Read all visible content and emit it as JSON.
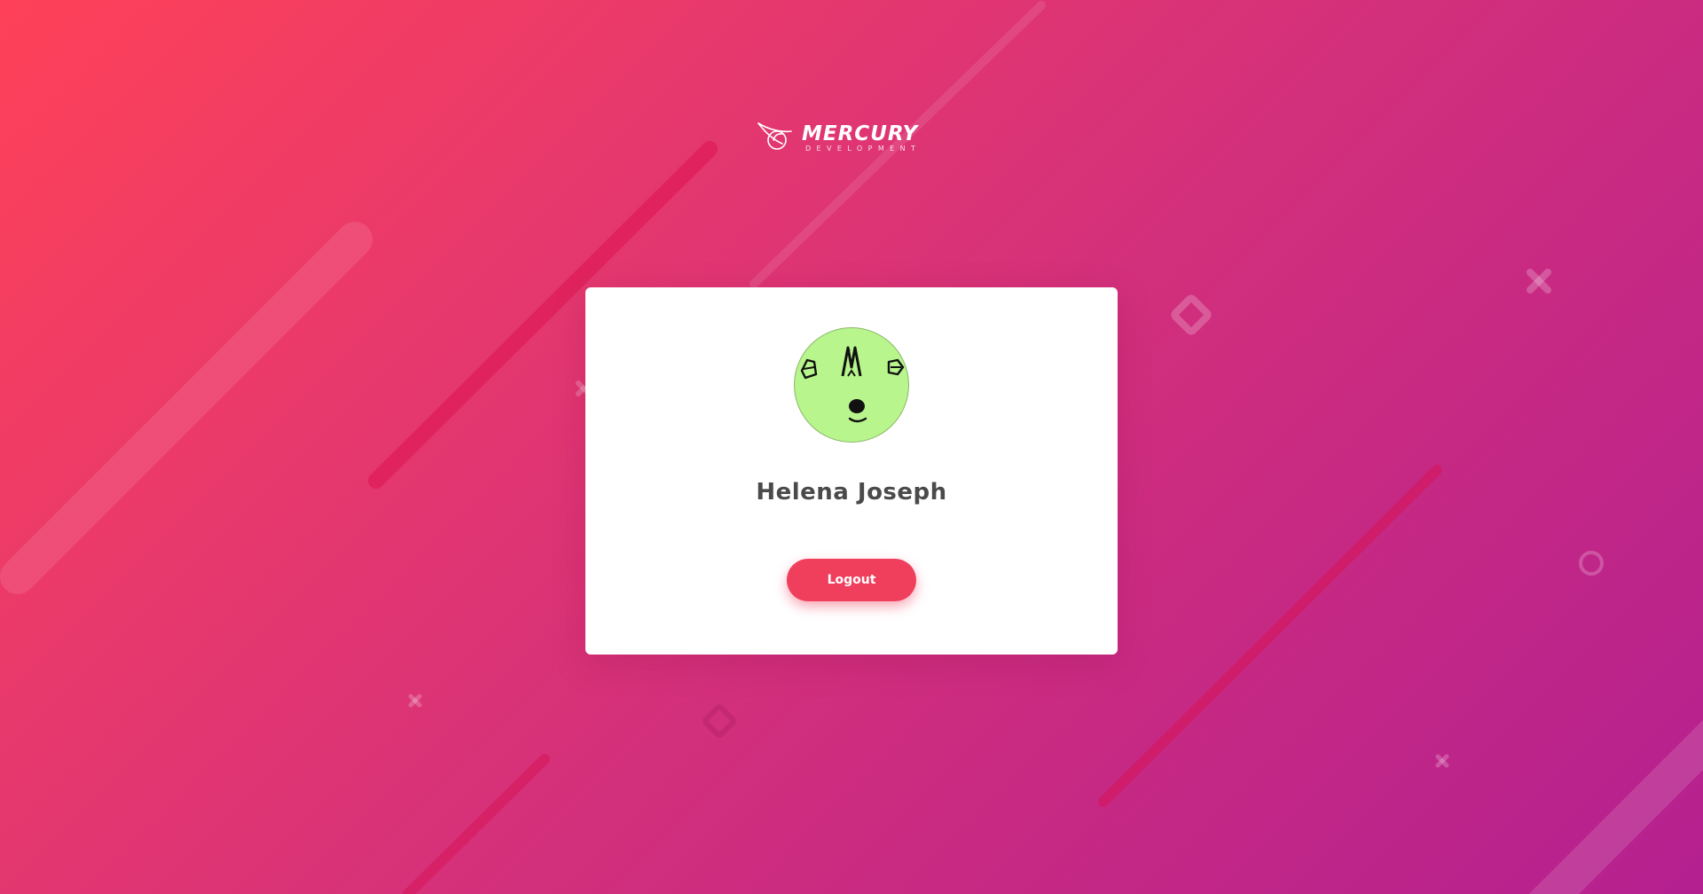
{
  "brand": {
    "name": "MERCURY",
    "tagline": "DEVELOPMENT"
  },
  "profile": {
    "user_name": "Helena Joseph",
    "avatar_icon": "identicon-face-icon",
    "avatar_color": "#b8f58c"
  },
  "actions": {
    "logout_label": "Logout"
  },
  "colors": {
    "accent": "#ef3f5d",
    "gradient_start": "#fe4158",
    "gradient_end": "#b42090",
    "card_background": "#ffffff",
    "name_text": "#4a4a4a"
  }
}
